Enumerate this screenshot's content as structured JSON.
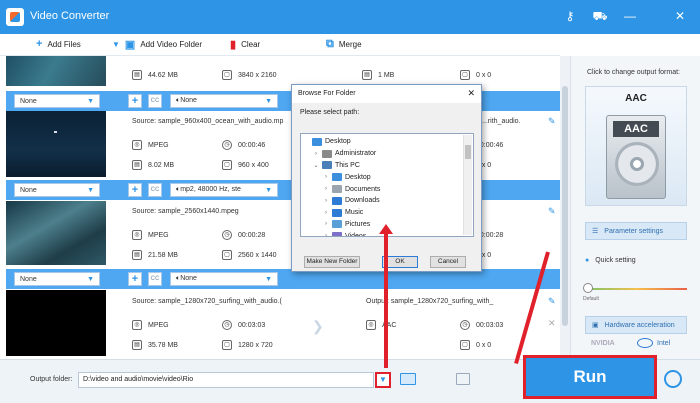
{
  "app": {
    "title": "Video Converter"
  },
  "toolbar": {
    "add_files": "Add Files",
    "add_video_folder": "Add Video Folder",
    "clear": "Clear",
    "merge": "Merge"
  },
  "files": [
    {
      "source": "",
      "src_format": "",
      "src_duration": "",
      "src_size": "44.62 MB",
      "src_resolution": "3840 x 2160",
      "out_size": "1 MB",
      "out_resolution": "0 x 0",
      "subtitle": "None",
      "audio": "None",
      "thumb": "ocean-aerial"
    },
    {
      "source": "Source: sample_960x400_ocean_with_audio.mp",
      "src_format": "MPEG",
      "src_duration": "00:00:46",
      "src_size": "8.02 MB",
      "src_resolution": "960 x 400",
      "out_label": "...rith_audio.",
      "out_duration": "00:00:46",
      "out_resolution": "0 x 0",
      "subtitle": "None",
      "audio": "mp2, 48000 Hz, ste",
      "thumb": "dark-sky"
    },
    {
      "source": "Source: sample_2560x1440.mpeg",
      "src_format": "MPEG",
      "src_duration": "00:00:28",
      "src_size": "21.58 MB",
      "src_resolution": "2560 x 1440",
      "out_duration": "00:00:28",
      "out_resolution": "0 x 0",
      "subtitle": "None",
      "audio": "None",
      "thumb": "coastline"
    },
    {
      "source": "Source: sample_1280x720_surfing_with_audio.(",
      "src_format": "MPEG",
      "src_duration": "00:03:03",
      "src_size": "35.78 MB",
      "src_resolution": "1280 x 720",
      "out_label": "Output: sample_1280x720_surfing_with_",
      "out_format": "AAC",
      "out_duration": "00:03:03",
      "out_resolution": "0 x 0",
      "thumb": "black"
    }
  ],
  "right_panel": {
    "hint": "Click to change output format:",
    "format": "AAC",
    "format_card": "AAC",
    "parameter_settings": "Parameter settings",
    "quick_setting": "Quick setting",
    "default_label": "Default",
    "hardware_acceleration": "Hardware acceleration",
    "nvidia": "NVIDIA",
    "intel": "Intel"
  },
  "bottom": {
    "output_label": "Output folder:",
    "output_path": "D:\\video and audio\\movie\\video\\Rio",
    "run": "Run"
  },
  "dialog": {
    "title": "Browse For Folder",
    "prompt": "Please select path:",
    "tree": [
      {
        "label": "Desktop",
        "indent": 0,
        "toggle": "",
        "color": "#3c8fdc"
      },
      {
        "label": "Administrator",
        "indent": 1,
        "toggle": ">",
        "color": "#8a8a8a"
      },
      {
        "label": "This PC",
        "indent": 1,
        "toggle": "v",
        "color": "#4a7fb8"
      },
      {
        "label": "Desktop",
        "indent": 2,
        "toggle": ">",
        "color": "#3c8fdc"
      },
      {
        "label": "Documents",
        "indent": 2,
        "toggle": ">",
        "color": "#9aa5b0"
      },
      {
        "label": "Downloads",
        "indent": 2,
        "toggle": ">",
        "color": "#2e7bd6"
      },
      {
        "label": "Music",
        "indent": 2,
        "toggle": ">",
        "color": "#2e7bd6"
      },
      {
        "label": "Pictures",
        "indent": 2,
        "toggle": ">",
        "color": "#5aa0d8"
      },
      {
        "label": "Videos",
        "indent": 2,
        "toggle": ">",
        "color": "#7b6fc9"
      }
    ],
    "make_new_folder": "Make New Folder",
    "ok": "OK",
    "cancel": "Cancel"
  },
  "colors": {
    "accent": "#2e95e6",
    "annotation_red": "#e0202a",
    "settings_bar": "#4ea7f0"
  }
}
